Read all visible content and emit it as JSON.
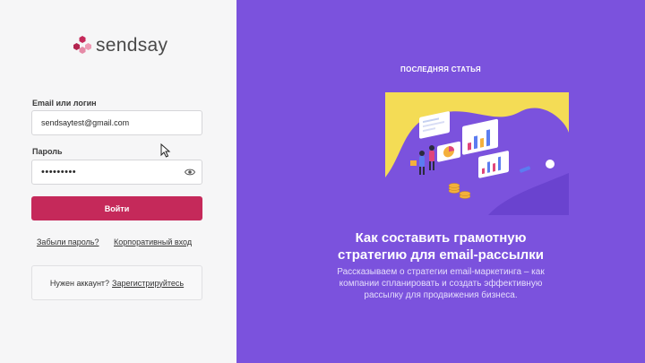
{
  "brand": {
    "name": "sendsay"
  },
  "login": {
    "email_label": "Email или логин",
    "email_value": "sendsaytest@gmail.com",
    "password_label": "Пароль",
    "password_value": "•••••••••",
    "submit_label": "Войти",
    "forgot_link": "Забыли пароль?",
    "corporate_link": "Корпоративный вход",
    "register_prompt": "Нужен аккаунт?",
    "register_link": "Зарегистрируйтесь"
  },
  "promo": {
    "section_label": "ПОСЛЕДНЯЯ СТАТЬЯ",
    "article_title": "Как составить грамотную стратегию для email-рассылки",
    "article_description": "Рассказываем о стратегии email-маркетинга – как компании спланировать и создать эффективную рассылку для продвижения бизнеса."
  },
  "colors": {
    "brand_accent": "#c5295a",
    "promo_background": "#7b52dd",
    "illustration_background": "#f4dc55"
  },
  "icons": {
    "logo": "hexagon-cluster-icon",
    "password_toggle": "eye-icon",
    "cursor": "mouse-pointer-icon"
  }
}
